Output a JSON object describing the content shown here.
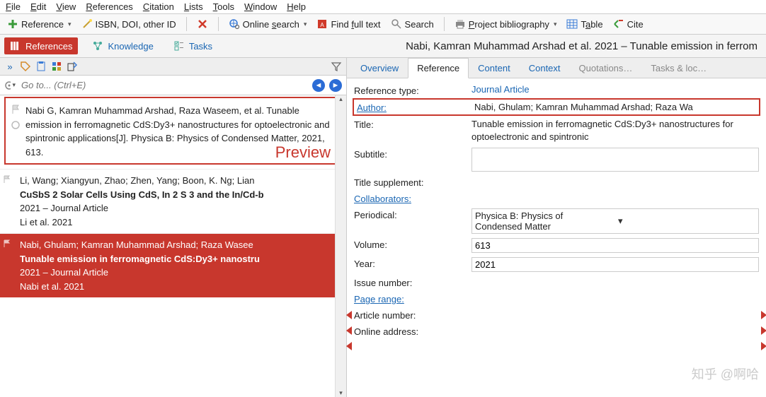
{
  "menu": [
    "File",
    "Edit",
    "View",
    "References",
    "Citation",
    "Lists",
    "Tools",
    "Window",
    "Help"
  ],
  "toolbar": {
    "reference": "Reference",
    "isbn": "ISBN, DOI, other ID",
    "online_search": "Online search",
    "find_full": "Find full text",
    "search": "Search",
    "project_bib": "Project bibliography",
    "table": "Table",
    "cite": "Cite"
  },
  "viewtabs": {
    "references": "References",
    "knowledge": "Knowledge",
    "tasks": "Tasks"
  },
  "doctitle": "Nabi, Kamran Muhammad Arshad et al. 2021 – Tunable emission in ferrom",
  "search_placeholder": "Go to... (Ctrl+E)",
  "preview": {
    "text": "Nabi G, Kamran Muhammad Arshad, Raza Waseem, et al. Tunable emission in ferromagnetic CdS:Dy3+ nanostructures for optoelectronic and spintronic applications[J]. Physica B: Physics of Condensed Matter, 2021, 613.",
    "label": "Preview"
  },
  "items": [
    {
      "authors": "Li, Wang; Xiangyun, Zhao; Zhen, Yang; Boon, K. Ng; Lian",
      "title": "CuSbS 2 Solar Cells Using CdS, In 2 S 3 and the In/Cd-b",
      "meta": "2021 – Journal Article",
      "short": "Li et al. 2021"
    },
    {
      "authors": "Nabi, Ghulam; Kamran Muhammad Arshad; Raza Wasee",
      "title": "Tunable emission in ferromagnetic CdS:Dy3+ nanostru",
      "meta": "2021 – Journal Article",
      "short": "Nabi et al. 2021"
    }
  ],
  "rtabs": [
    "Overview",
    "Reference",
    "Content",
    "Context",
    "Quotations…",
    "Tasks & loc…"
  ],
  "form": {
    "reference_type_label": "Reference type:",
    "reference_type_value": "Journal Article",
    "author_label": "Author:",
    "author_value": "Nabi, Ghulam; Kamran Muhammad Arshad; Raza Wa",
    "title_label": "Title:",
    "title_value": "Tunable emission in ferromagnetic CdS:Dy3+ nanostructures for optoelectronic and spintronic",
    "subtitle_label": "Subtitle:",
    "subtitle_value": "",
    "title_supp_label": "Title supplement:",
    "collab_label": "Collaborators:",
    "periodical_label": "Periodical:",
    "periodical_value": "Physica B: Physics of Condensed Matter",
    "volume_label": "Volume:",
    "volume_value": "613",
    "year_label": "Year:",
    "year_value": "2021",
    "issue_label": "Issue number:",
    "pagerange_label": "Page range:",
    "article_no_label": "Article number:",
    "online_addr_label": "Online address:"
  },
  "watermark": "知乎 @啊哈"
}
